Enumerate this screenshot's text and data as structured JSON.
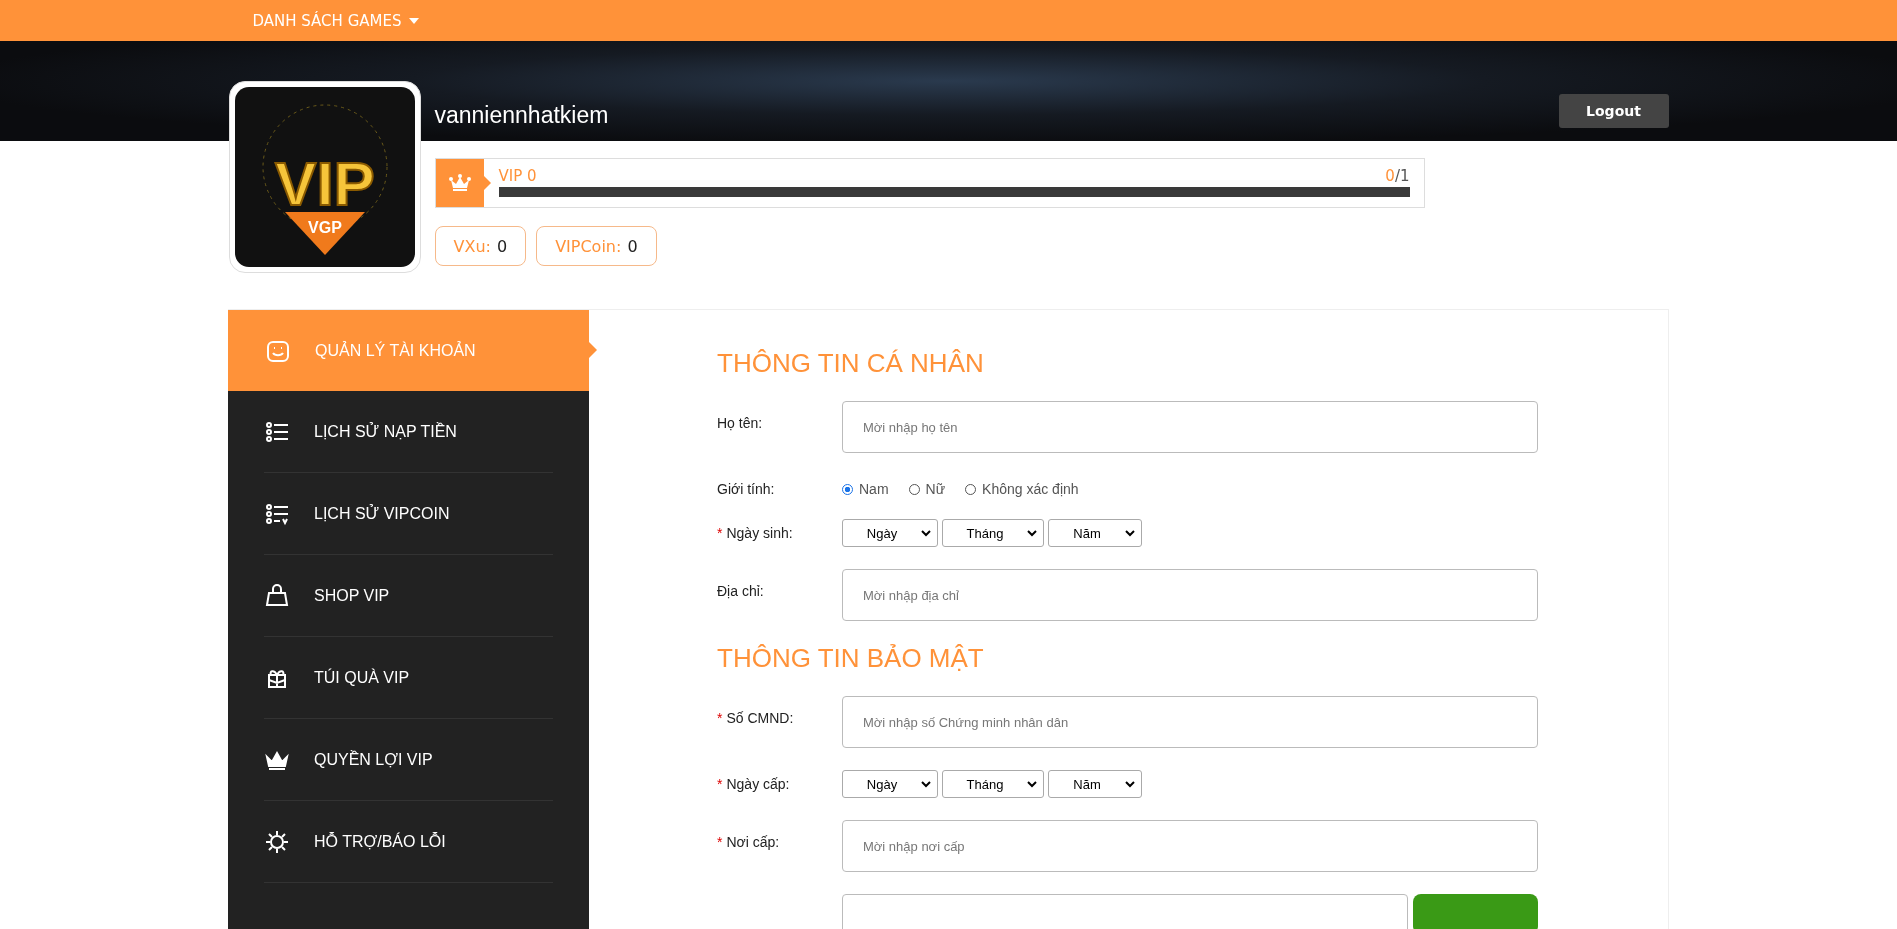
{
  "top_nav": {
    "menu": "DANH SÁCH GAMES"
  },
  "profile": {
    "avatar": {
      "logo_text": "VIP",
      "logo_subtext": "VGP"
    },
    "username": "vanniennhatkiem",
    "logout": "Logout",
    "vip": {
      "label": "VIP 0",
      "current": "0",
      "total": "/1",
      "level": 0
    },
    "balances": [
      {
        "label": "VXu:",
        "value": "0"
      },
      {
        "label": "VIPCoin:",
        "value": "0"
      }
    ]
  },
  "sidebar": {
    "items": [
      {
        "label": "QUẢN LÝ TÀI KHOẢN",
        "kind": "face",
        "selected": true
      },
      {
        "label": "LỊCH SỬ NẠP TIỀN",
        "kind": "list",
        "selected": false
      },
      {
        "label": "LỊCH SỬ VIPCOIN",
        "kind": "list-v",
        "selected": false
      },
      {
        "label": "SHOP VIP",
        "kind": "bag",
        "selected": false
      },
      {
        "label": "TÚI QUÀ VIP",
        "kind": "gift",
        "selected": false
      },
      {
        "label": "QUYỀN LỢI VIP",
        "kind": "crown",
        "selected": false
      },
      {
        "label": "HỖ TRỢ/BÁO LỖI",
        "kind": "gear",
        "selected": false
      }
    ]
  },
  "sections": [
    {
      "title": "THÔNG TIN CÁ NHÂN",
      "fields": [
        {
          "kind": "text",
          "label": "Họ tên:",
          "placeholder": "Mời nhập họ tên"
        },
        {
          "kind": "radio",
          "label": "Giới tính:",
          "options": [
            {
              "label": "Nam",
              "selected": true
            },
            {
              "label": "Nữ",
              "selected": false
            },
            {
              "label": "Không xác định",
              "selected": false
            }
          ]
        },
        {
          "kind": "date",
          "label": "Ngày sinh:",
          "required_mark": "*",
          "selects": [
            "Ngày",
            "Tháng",
            "Năm"
          ]
        },
        {
          "kind": "text",
          "label": "Địa chỉ:",
          "placeholder": "Mời nhập địa chỉ"
        }
      ]
    },
    {
      "title": "THÔNG TIN BẢO MẬT",
      "fields": [
        {
          "kind": "text",
          "label": "Số CMND:",
          "required_mark": "*",
          "placeholder": "Mời nhập số Chứng minh nhân dân"
        },
        {
          "kind": "date",
          "label": "Ngày cấp:",
          "required_mark": "*",
          "selects": [
            "Ngày",
            "Tháng",
            "Năm"
          ]
        },
        {
          "kind": "text",
          "label": "Nơi cấp:",
          "required_mark": "*",
          "placeholder": "Mời nhập nơi cấp"
        },
        {
          "kind": "input_button"
        }
      ]
    }
  ]
}
